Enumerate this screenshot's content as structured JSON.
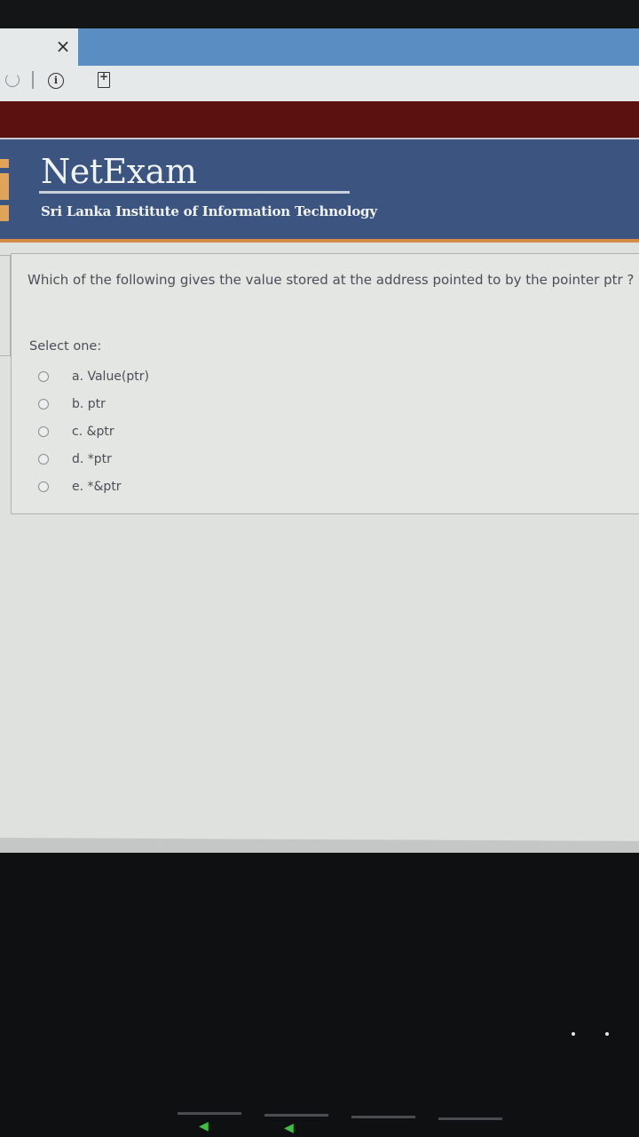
{
  "browser": {
    "close_glyph": "×",
    "info_glyph": "i",
    "icons": [
      "close-icon",
      "reload-icon",
      "info-icon",
      "add-page-icon"
    ]
  },
  "header": {
    "brand": "NetExam",
    "institute": "Sri Lanka Institute of Information Technology"
  },
  "quiz": {
    "question": "Which of the following gives the value stored at the address pointed to by the pointer ptr ?",
    "select_label": "Select one:",
    "options": [
      {
        "label": "a. Value(ptr)"
      },
      {
        "label": "b. ptr"
      },
      {
        "label": "c. &ptr"
      },
      {
        "label": "d. *ptr"
      },
      {
        "label": "e. *&ptr"
      }
    ]
  },
  "colors": {
    "header_bg": "#3c5480",
    "maroon_band": "#5c1111",
    "accent_strip": "#d38a45",
    "tab_blue": "#5a8ec2",
    "text": "#4a4f57"
  }
}
